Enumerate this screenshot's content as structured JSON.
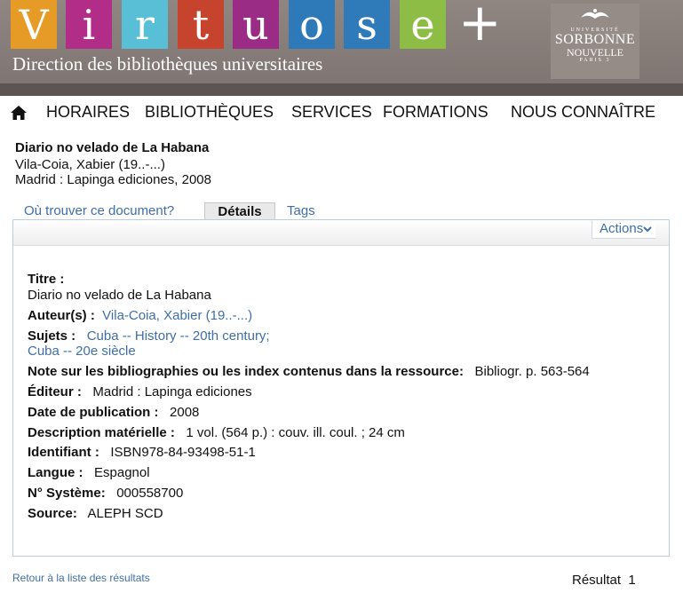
{
  "banner": {
    "letters": [
      "V",
      "i",
      "r",
      "t",
      "u",
      "o",
      "s",
      "e"
    ],
    "letter_colors": [
      "#e79b27",
      "#b12d87",
      "#59bfd6",
      "#c6442e",
      "#9b2c86",
      "#2e7ab8",
      "#2f7ab9",
      "#8dbd45"
    ],
    "plus": "+",
    "subtitle": "Direction des bibliothèques universitaires",
    "logo": {
      "univ": "UNIVERSITÉ",
      "line1": "SORBONNE",
      "line2": "NOUVELLE",
      "line3": "PARIS 3"
    }
  },
  "nav": {
    "items": [
      "HORAIRES",
      "BIBLIOTHÈQUES",
      "SERVICES",
      "FORMATIONS",
      "NOUS CONNAÎTRE"
    ]
  },
  "record": {
    "title": "Diario no velado de La Habana",
    "author": "Vila-Coia, Xabier (19..-...)",
    "publication": "Madrid : Lapinga ediciones, 2008"
  },
  "tabs": {
    "where": "Où trouver ce document?",
    "details": "Détails",
    "tags": "Tags"
  },
  "panel": {
    "actions": "Actions",
    "titre_label": "Titre :",
    "titre_value": "Diario no velado de La Habana",
    "auteur_label": "Auteur(s) :",
    "auteur_value": "Vila-Coia, Xabier (19..-...)",
    "sujets_label": "Sujets :",
    "sujet1": "Cuba -- History -- 20th century;",
    "sujet2": "Cuba -- 20e siècle",
    "note_label": "Note sur les bibliographies ou les index contenus dans la ressource:",
    "note_value": "Bibliogr. p. 563-564",
    "editeur_label": "Éditeur :",
    "editeur_value": "Madrid : Lapinga ediciones",
    "date_label": "Date de publication :",
    "date_value": "2008",
    "desc_label": "Description matérielle :",
    "desc_value": "1 vol. (564 p.) : couv. ill. coul. ; 24 cm",
    "ident_label": "Identifiant :",
    "ident_value": "ISBN978-84-93498-51-1",
    "langue_label": "Langue :",
    "langue_value": "Espagnol",
    "systeme_label": "N° Système:",
    "systeme_value": "000558700",
    "source_label": "Source:",
    "source_value": "ALEPH SCD"
  },
  "footer": {
    "back": "Retour à la liste des résultats",
    "result_label": "Résultat",
    "result_number": "1"
  }
}
